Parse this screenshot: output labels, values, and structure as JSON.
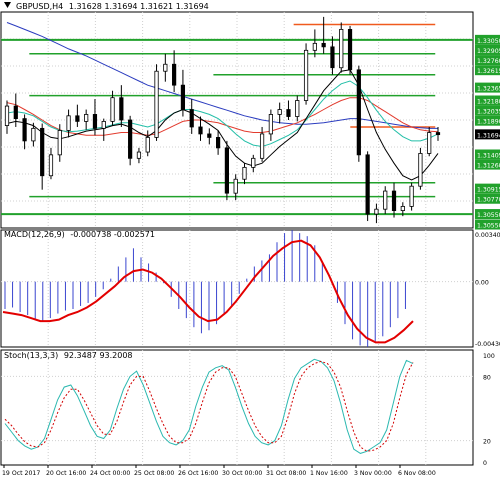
{
  "colors": {
    "bg": "#ffffff",
    "grid": "#d0d0d0",
    "candle_up": "#ffffff",
    "candle_down": "#000000",
    "candle_outline": "#000000",
    "ma_fast": "#000000",
    "ma_mid": "#e23b2e",
    "ma_slow": "#2c8fd6",
    "ma_teal": "#23bfa8",
    "ma_blue": "#2b3cbf",
    "level_green": "#21a12b",
    "level_red": "#f05a1e",
    "macd_hist": "#3a45cf",
    "macd_signal": "#e30000",
    "stoch_main": "#2bb8b0",
    "stoch_signal": "#d10000",
    "axis_label_bg": "#21a12b",
    "price_tag_bg": "#000000"
  },
  "chart_data": [
    {
      "type": "candlestick",
      "title": "GBPUSD,H4  1.31628 1.31694 1.31621 1.31694",
      "symbol_label": "GBPUSD,H4",
      "ohlc_header": "1.31628 1.31694 1.31621 1.31694",
      "price_axis_ticks": [
        "1.33050",
        "1.32365",
        "1.32000",
        "1.31405",
        "1.30915",
        "1.30550",
        "1.30550"
      ],
      "price_axis_labels_all": [
        "1.33050",
        "1.32905",
        "1.32760",
        "1.32615",
        "1.32365",
        "1.32180",
        "1.32035",
        "1.31890",
        "1.31694",
        "1.31405",
        "1.31260",
        "1.30915",
        "1.30770",
        "1.30550",
        "1.30550"
      ],
      "ylim": [
        1.3035,
        1.3345
      ],
      "current_price": "1.31694",
      "levels_green": [
        1.3305,
        1.3285,
        1.3255,
        1.3225,
        1.31,
        1.308,
        1.3055
      ],
      "levels_red": [
        1.3327,
        1.318
      ],
      "candles": [
        {
          "t": 0,
          "o": 1.3182,
          "h": 1.3218,
          "l": 1.317,
          "c": 1.321
        },
        {
          "t": 1,
          "o": 1.321,
          "h": 1.3228,
          "l": 1.318,
          "c": 1.3192
        },
        {
          "t": 2,
          "o": 1.3192,
          "h": 1.3198,
          "l": 1.3148,
          "c": 1.316
        },
        {
          "t": 3,
          "o": 1.316,
          "h": 1.3186,
          "l": 1.3152,
          "c": 1.3178
        },
        {
          "t": 4,
          "o": 1.3178,
          "h": 1.3185,
          "l": 1.309,
          "c": 1.311
        },
        {
          "t": 5,
          "o": 1.311,
          "h": 1.315,
          "l": 1.3105,
          "c": 1.314
        },
        {
          "t": 6,
          "o": 1.314,
          "h": 1.3184,
          "l": 1.313,
          "c": 1.3175
        },
        {
          "t": 7,
          "o": 1.3175,
          "h": 1.3205,
          "l": 1.3165,
          "c": 1.3196
        },
        {
          "t": 8,
          "o": 1.3196,
          "h": 1.3212,
          "l": 1.318,
          "c": 1.3188
        },
        {
          "t": 9,
          "o": 1.3188,
          "h": 1.3205,
          "l": 1.3176,
          "c": 1.3198
        },
        {
          "t": 10,
          "o": 1.3198,
          "h": 1.322,
          "l": 1.3168,
          "c": 1.3178
        },
        {
          "t": 11,
          "o": 1.3178,
          "h": 1.3192,
          "l": 1.316,
          "c": 1.3188
        },
        {
          "t": 12,
          "o": 1.3188,
          "h": 1.3232,
          "l": 1.3182,
          "c": 1.3222
        },
        {
          "t": 13,
          "o": 1.3222,
          "h": 1.324,
          "l": 1.318,
          "c": 1.319
        },
        {
          "t": 14,
          "o": 1.319,
          "h": 1.3196,
          "l": 1.3125,
          "c": 1.3135
        },
        {
          "t": 15,
          "o": 1.3135,
          "h": 1.315,
          "l": 1.3128,
          "c": 1.3144
        },
        {
          "t": 16,
          "o": 1.3144,
          "h": 1.3175,
          "l": 1.3138,
          "c": 1.3165
        },
        {
          "t": 17,
          "o": 1.3165,
          "h": 1.327,
          "l": 1.316,
          "c": 1.326
        },
        {
          "t": 18,
          "o": 1.326,
          "h": 1.3285,
          "l": 1.3245,
          "c": 1.327
        },
        {
          "t": 19,
          "o": 1.327,
          "h": 1.329,
          "l": 1.323,
          "c": 1.324
        },
        {
          "t": 20,
          "o": 1.324,
          "h": 1.3262,
          "l": 1.3195,
          "c": 1.3205
        },
        {
          "t": 21,
          "o": 1.3205,
          "h": 1.322,
          "l": 1.317,
          "c": 1.318
        },
        {
          "t": 22,
          "o": 1.318,
          "h": 1.3195,
          "l": 1.316,
          "c": 1.317
        },
        {
          "t": 23,
          "o": 1.317,
          "h": 1.3178,
          "l": 1.3155,
          "c": 1.3165
        },
        {
          "t": 24,
          "o": 1.3165,
          "h": 1.3175,
          "l": 1.314,
          "c": 1.315
        },
        {
          "t": 25,
          "o": 1.315,
          "h": 1.316,
          "l": 1.3075,
          "c": 1.3085
        },
        {
          "t": 26,
          "o": 1.3085,
          "h": 1.3112,
          "l": 1.3075,
          "c": 1.3105
        },
        {
          "t": 27,
          "o": 1.3105,
          "h": 1.3128,
          "l": 1.3098,
          "c": 1.3122
        },
        {
          "t": 28,
          "o": 1.3122,
          "h": 1.314,
          "l": 1.3115,
          "c": 1.3135
        },
        {
          "t": 29,
          "o": 1.3135,
          "h": 1.318,
          "l": 1.313,
          "c": 1.317
        },
        {
          "t": 30,
          "o": 1.317,
          "h": 1.3205,
          "l": 1.316,
          "c": 1.3198
        },
        {
          "t": 31,
          "o": 1.3198,
          "h": 1.3215,
          "l": 1.3185,
          "c": 1.3205
        },
        {
          "t": 32,
          "o": 1.3205,
          "h": 1.3218,
          "l": 1.319,
          "c": 1.3195
        },
        {
          "t": 33,
          "o": 1.3195,
          "h": 1.3225,
          "l": 1.3188,
          "c": 1.3218
        },
        {
          "t": 34,
          "o": 1.3218,
          "h": 1.33,
          "l": 1.3212,
          "c": 1.329
        },
        {
          "t": 35,
          "o": 1.329,
          "h": 1.332,
          "l": 1.328,
          "c": 1.33
        },
        {
          "t": 36,
          "o": 1.33,
          "h": 1.3338,
          "l": 1.3285,
          "c": 1.3295
        },
        {
          "t": 37,
          "o": 1.3295,
          "h": 1.331,
          "l": 1.3255,
          "c": 1.3265
        },
        {
          "t": 38,
          "o": 1.3265,
          "h": 1.333,
          "l": 1.3258,
          "c": 1.332
        },
        {
          "t": 39,
          "o": 1.332,
          "h": 1.3325,
          "l": 1.3255,
          "c": 1.3262
        },
        {
          "t": 40,
          "o": 1.3262,
          "h": 1.3268,
          "l": 1.313,
          "c": 1.314
        },
        {
          "t": 41,
          "o": 1.314,
          "h": 1.3145,
          "l": 1.3045,
          "c": 1.3055
        },
        {
          "t": 42,
          "o": 1.3055,
          "h": 1.307,
          "l": 1.3042,
          "c": 1.3062
        },
        {
          "t": 43,
          "o": 1.3062,
          "h": 1.3095,
          "l": 1.3055,
          "c": 1.3088
        },
        {
          "t": 44,
          "o": 1.3088,
          "h": 1.31,
          "l": 1.305,
          "c": 1.306
        },
        {
          "t": 45,
          "o": 1.306,
          "h": 1.3072,
          "l": 1.3052,
          "c": 1.3066
        },
        {
          "t": 46,
          "o": 1.3066,
          "h": 1.31,
          "l": 1.306,
          "c": 1.3095
        },
        {
          "t": 47,
          "o": 1.3095,
          "h": 1.315,
          "l": 1.309,
          "c": 1.3142
        },
        {
          "t": 48,
          "o": 1.3142,
          "h": 1.318,
          "l": 1.3138,
          "c": 1.3172
        },
        {
          "t": 49,
          "o": 1.3172,
          "h": 1.318,
          "l": 1.316,
          "c": 1.3169
        }
      ],
      "ma_black": [
        1.3185,
        1.3188,
        1.3186,
        1.3182,
        1.3172,
        1.3165,
        1.3163,
        1.3166,
        1.317,
        1.3174,
        1.3176,
        1.3178,
        1.3182,
        1.3184,
        1.318,
        1.3172,
        1.3166,
        1.3175,
        1.319,
        1.32,
        1.3205,
        1.32,
        1.3192,
        1.3184,
        1.3175,
        1.3155,
        1.3138,
        1.3128,
        1.3124,
        1.3128,
        1.314,
        1.3152,
        1.3162,
        1.3172,
        1.3192,
        1.3212,
        1.3232,
        1.3246,
        1.326,
        1.3262,
        1.324,
        1.3205,
        1.3172,
        1.3148,
        1.3128,
        1.311,
        1.3104,
        1.311,
        1.3125,
        1.3142
      ],
      "ma_red": [
        1.3215,
        1.3212,
        1.3205,
        1.3198,
        1.319,
        1.3182,
        1.3176,
        1.3172,
        1.317,
        1.3168,
        1.3168,
        1.3168,
        1.317,
        1.3172,
        1.3172,
        1.317,
        1.3168,
        1.317,
        1.3176,
        1.3182,
        1.3188,
        1.319,
        1.319,
        1.3188,
        1.3186,
        1.3182,
        1.3178,
        1.3174,
        1.3172,
        1.3172,
        1.3174,
        1.3178,
        1.3182,
        1.3186,
        1.3192,
        1.3198,
        1.3205,
        1.3212,
        1.3218,
        1.3222,
        1.3222,
        1.3218,
        1.321,
        1.3202,
        1.3194,
        1.3186,
        1.318,
        1.3176,
        1.3174,
        1.3173
      ],
      "ma_teal": [
        1.32,
        1.3202,
        1.32,
        1.3196,
        1.3188,
        1.318,
        1.3175,
        1.3173,
        1.3174,
        1.3176,
        1.3178,
        1.318,
        1.3183,
        1.3186,
        1.3186,
        1.3183,
        1.318,
        1.3184,
        1.3192,
        1.32,
        1.3205,
        1.3205,
        1.3202,
        1.3198,
        1.3192,
        1.3182,
        1.317,
        1.316,
        1.3154,
        1.3152,
        1.3156,
        1.3162,
        1.3168,
        1.3176,
        1.319,
        1.3205,
        1.322,
        1.3232,
        1.3242,
        1.3246,
        1.3238,
        1.3222,
        1.3204,
        1.3188,
        1.3176,
        1.3166,
        1.316,
        1.316,
        1.3164,
        1.317
      ],
      "ma_blue": [
        1.333,
        1.3325,
        1.332,
        1.3315,
        1.331,
        1.3304,
        1.3298,
        1.3292,
        1.3287,
        1.3282,
        1.3276,
        1.327,
        1.3264,
        1.3258,
        1.3252,
        1.3246,
        1.324,
        1.3236,
        1.3232,
        1.3228,
        1.3224,
        1.322,
        1.3216,
        1.3212,
        1.3208,
        1.3204,
        1.32,
        1.3196,
        1.3193,
        1.319,
        1.3188,
        1.3186,
        1.3185,
        1.3184,
        1.3184,
        1.3185,
        1.3186,
        1.3188,
        1.319,
        1.3192,
        1.3192,
        1.319,
        1.3188,
        1.3186,
        1.3184,
        1.3182,
        1.318,
        1.3179,
        1.3178,
        1.3178
      ]
    },
    {
      "type": "bar",
      "title": "MACD(12,26,9) -0.000738 -0.002571",
      "label": "MACD(12,26,9)",
      "values_header": "-0.000738 -0.002571",
      "axis_labels": [
        "0.003406",
        "0.00",
        "-0.004305"
      ],
      "ylim": [
        -0.004305,
        0.003406
      ],
      "histogram": [
        -0.0018,
        -0.0017,
        -0.002,
        -0.0022,
        -0.0025,
        -0.0026,
        -0.0024,
        -0.0021,
        -0.0019,
        -0.0018,
        -0.0016,
        -0.0014,
        -0.001,
        -0.0005,
        0.0002,
        0.001,
        0.0016,
        0.0022,
        0.0016,
        0.0012,
        0.0006,
        -0.0001,
        -0.001,
        -0.0018,
        -0.0024,
        -0.003,
        -0.0034,
        -0.0032,
        -0.0028,
        -0.0022,
        -0.0016,
        -0.0008,
        0.0002,
        0.001,
        0.0014,
        0.0018,
        0.0026,
        0.0032,
        0.0034,
        0.0032,
        0.003,
        0.0024,
        0.0012,
        0.0,
        -0.0014,
        -0.0028,
        -0.0038,
        -0.0042,
        -0.0043,
        -0.004,
        -0.0036,
        -0.003,
        -0.0024,
        -0.0018,
        0.0
      ],
      "signal": [
        -0.002,
        -0.0021,
        -0.0022,
        -0.0024,
        -0.0026,
        -0.0026,
        -0.0025,
        -0.0022,
        -0.002,
        -0.0017,
        -0.0013,
        -0.0008,
        -0.0003,
        0.0003,
        0.0007,
        0.0008,
        0.0006,
        0.0002,
        -0.0004,
        -0.001,
        -0.0017,
        -0.0023,
        -0.0026,
        -0.0025,
        -0.002,
        -0.0013,
        -0.0005,
        0.0003,
        0.001,
        0.0017,
        0.0022,
        0.0026,
        0.0027,
        0.0024,
        0.0016,
        0.0004,
        -0.001,
        -0.0022,
        -0.0031,
        -0.0037,
        -0.004,
        -0.004,
        -0.0037,
        -0.0032,
        -0.0026
      ]
    },
    {
      "type": "line",
      "title": "Stoch(13,3,3) 92.3487 93.2008",
      "label": "Stoch(13,3,3)",
      "values_header": "92.3487 93.2008",
      "axis_labels": [
        "100",
        "80",
        "20",
        "0"
      ],
      "ylim": [
        0,
        100
      ],
      "main": [
        36,
        28,
        20,
        15,
        12,
        14,
        22,
        40,
        58,
        70,
        72,
        62,
        48,
        34,
        24,
        22,
        30,
        50,
        68,
        80,
        85,
        72,
        55,
        38,
        24,
        18,
        16,
        20,
        30,
        52,
        70,
        84,
        88,
        90,
        86,
        70,
        52,
        36,
        24,
        18,
        16,
        20,
        34,
        58,
        78,
        88,
        92,
        96,
        94,
        88,
        76,
        55,
        30,
        12,
        8,
        10,
        14,
        18,
        30,
        55,
        80,
        95,
        92
      ],
      "signal": [
        40,
        34,
        26,
        19,
        15,
        14,
        18,
        30,
        46,
        60,
        68,
        68,
        58,
        46,
        34,
        26,
        26,
        38,
        56,
        72,
        80,
        80,
        66,
        50,
        36,
        24,
        18,
        18,
        22,
        36,
        56,
        74,
        84,
        88,
        88,
        80,
        64,
        48,
        34,
        24,
        18,
        18,
        24,
        42,
        64,
        80,
        88,
        92,
        94,
        92,
        84,
        70,
        48,
        28,
        14,
        10,
        11,
        14,
        20,
        36,
        60,
        82,
        93
      ]
    }
  ],
  "x_axis_labels": [
    "19 Oct 2017",
    "20 Oct 16:00",
    "24 Oct 00:00",
    "25 Oct 08:00",
    "26 Oct 16:00",
    "30 Oct 00:00",
    "31 Oct 08:00",
    "1 Nov 16:00",
    "3 Nov 00:00",
    "6 Nov 08:00"
  ]
}
